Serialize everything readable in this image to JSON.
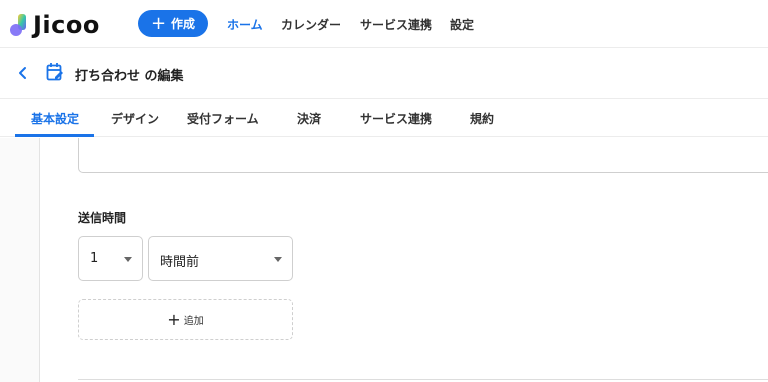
{
  "app": {
    "logo_text": "Jicoo"
  },
  "topnav": {
    "create_label": "作成",
    "links": [
      {
        "label": "ホーム",
        "active": true
      },
      {
        "label": "カレンダー",
        "active": false
      },
      {
        "label": "サービス連携",
        "active": false
      },
      {
        "label": "設定",
        "active": false
      }
    ]
  },
  "titlebar": {
    "title": "打ち合わせ の編集"
  },
  "tabs": [
    {
      "label": "基本設定",
      "active": true
    },
    {
      "label": "デザイン",
      "active": false
    },
    {
      "label": "受付フォーム",
      "active": false
    },
    {
      "label": "決済",
      "active": false
    },
    {
      "label": "サービス連携",
      "active": false
    },
    {
      "label": "規約",
      "active": false
    }
  ],
  "form": {
    "send_time_label": "送信時間",
    "amount_value": "1",
    "unit_value": "時間前",
    "add_label": "追加"
  },
  "colors": {
    "accent": "#1a73e8"
  }
}
